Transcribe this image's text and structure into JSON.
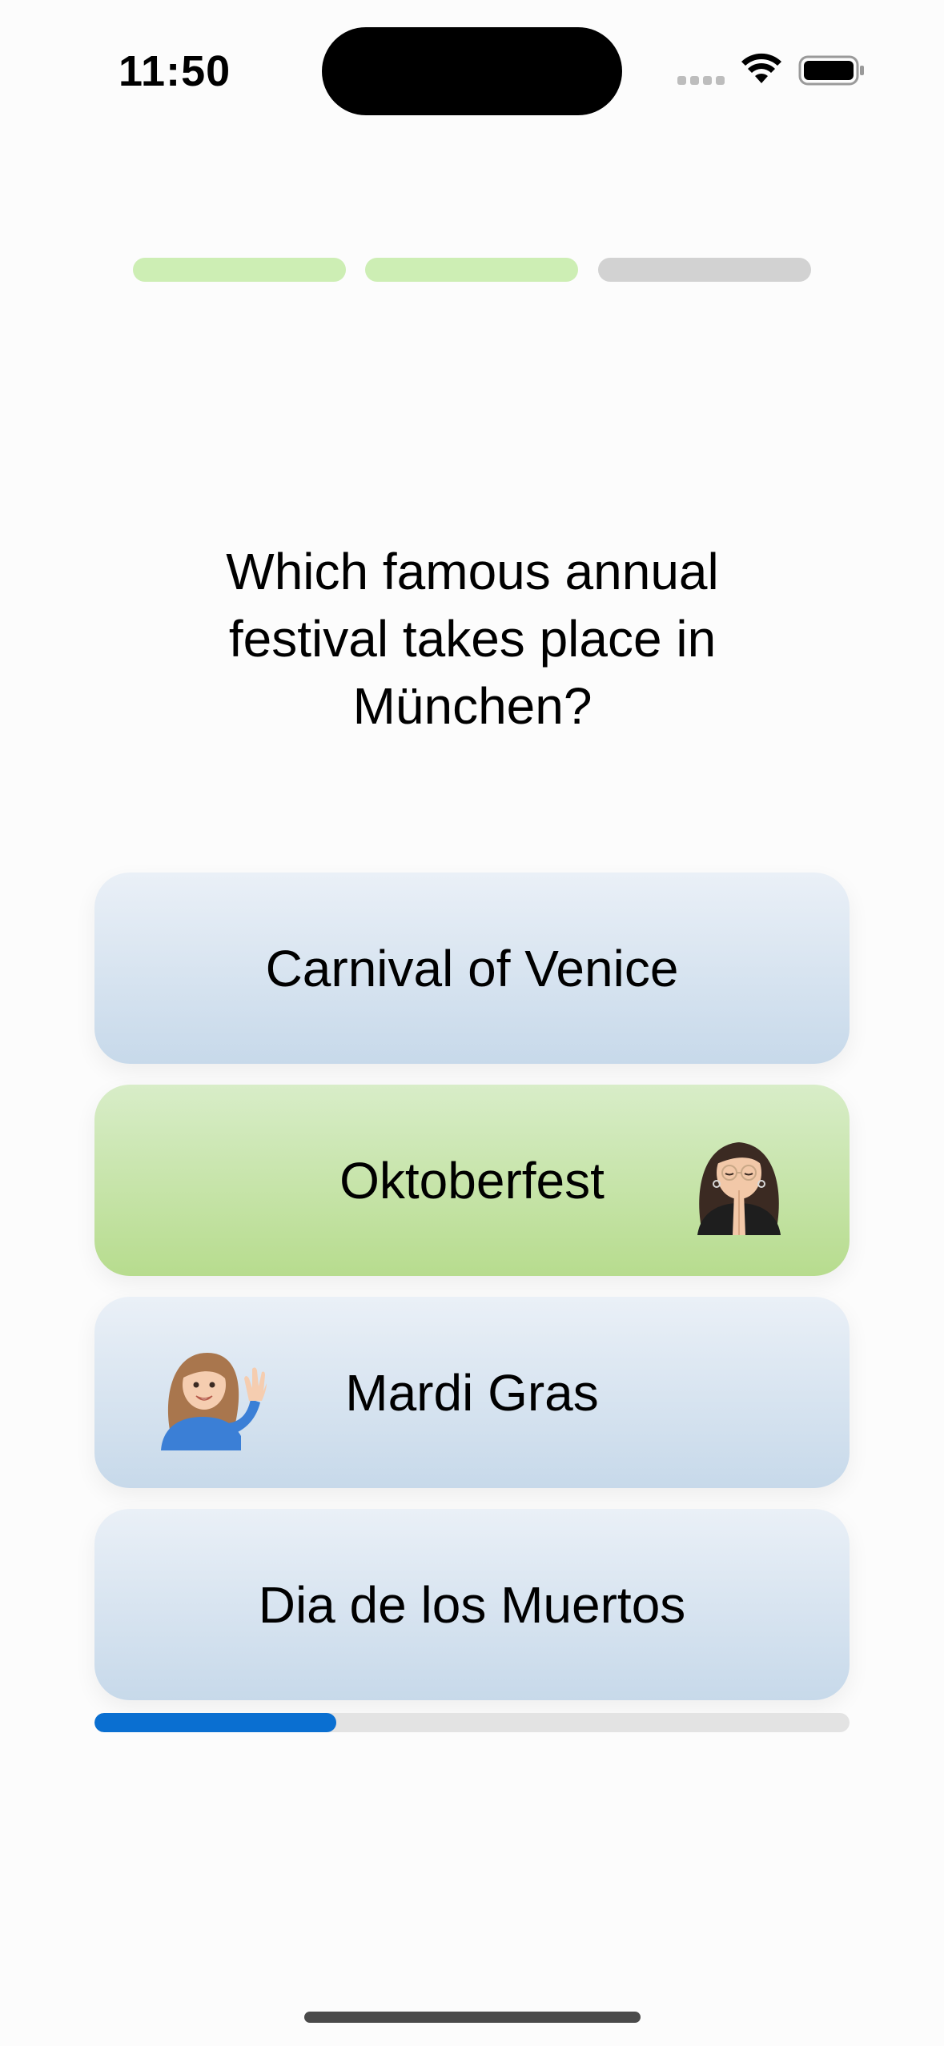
{
  "status_bar": {
    "time": "11:50"
  },
  "progress_steps": [
    {
      "state": "done"
    },
    {
      "state": "done"
    },
    {
      "state": "todo"
    }
  ],
  "question": {
    "text": "Which famous annual festival takes place in München?"
  },
  "answers": [
    {
      "label": "Carnival of Venice",
      "state": "neutral"
    },
    {
      "label": "Oktoberfest",
      "state": "correct",
      "avatar": "praying-memoji-icon"
    },
    {
      "label": "Mardi Gras",
      "state": "neutral",
      "avatar": "waving-memoji-icon"
    },
    {
      "label": "Dia de los Muertos",
      "state": "neutral"
    }
  ],
  "timer": {
    "progress": 0.32
  },
  "colors": {
    "correct": "#b7dc8e",
    "neutral": "#c7d9ea",
    "step_done": "#cdeeb4",
    "step_todo": "#d2d2d2",
    "timer_fill": "#0a6fd1"
  }
}
